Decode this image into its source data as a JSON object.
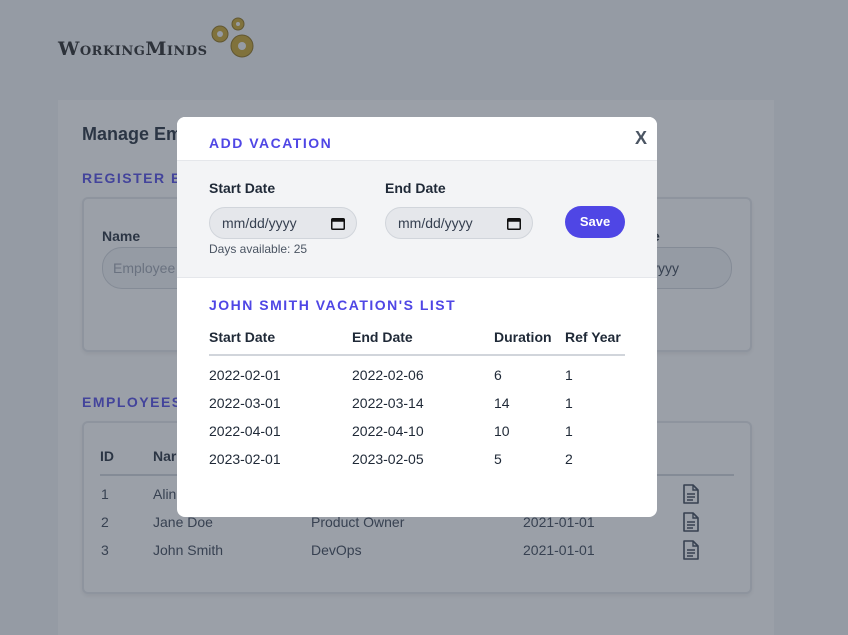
{
  "logo": {
    "text": "WorkingMinds"
  },
  "background": {
    "heading": "Manage Em",
    "register_heading": "REGISTER E",
    "name_label": "Name",
    "name_placeholder": "Employee",
    "right_label": "e",
    "right_input_value": "yyyy",
    "employees_heading": "EMPLOYEES",
    "table_headers": {
      "id": "ID",
      "name": "Nar"
    },
    "rows": [
      {
        "id": "1",
        "name": "Alin",
        "role": "",
        "date": ""
      },
      {
        "id": "2",
        "name": "Jane Doe",
        "role": "Product Owner",
        "date": "2021-01-01"
      },
      {
        "id": "3",
        "name": "John Smith",
        "role": "DevOps",
        "date": "2021-01-01"
      }
    ]
  },
  "modal": {
    "title": "ADD VACATION",
    "close_label": "X",
    "start_label": "Start Date",
    "end_label": "End Date",
    "start_placeholder": "mm/dd/yyyy",
    "end_placeholder": "mm/dd/yyyy",
    "days_available": "Days available: 25",
    "save_label": "Save",
    "list_title": "JOHN SMITH VACATION'S LIST",
    "columns": [
      "Start Date",
      "End Date",
      "Duration",
      "Ref Year"
    ],
    "rows": [
      [
        "2022-02-01",
        "2022-02-06",
        "6",
        "1"
      ],
      [
        "2022-03-01",
        "2022-03-14",
        "14",
        "1"
      ],
      [
        "2022-04-01",
        "2022-04-10",
        "10",
        "1"
      ],
      [
        "2023-02-01",
        "2023-02-05",
        "5",
        "2"
      ]
    ]
  },
  "colors": {
    "accent": "#4f46e5",
    "overlay": "#374151"
  }
}
